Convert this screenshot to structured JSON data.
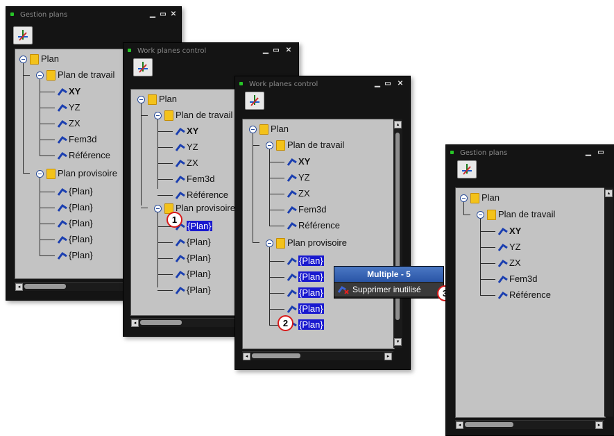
{
  "windows": [
    {
      "title": "Gestion plans",
      "tree": {
        "root": "Plan",
        "workplanes_folder": "Plan de travail",
        "workplanes": [
          "XY",
          "YZ",
          "ZX",
          "Fem3d",
          "Référence"
        ],
        "temp_folder": "Plan provisoire",
        "temp_planes": [
          "{Plan}",
          "{Plan}",
          "{Plan}",
          "{Plan}",
          "{Plan}"
        ]
      }
    },
    {
      "title": "Work planes control",
      "tree": {
        "root": "Plan",
        "workplanes_folder": "Plan de travail",
        "workplanes": [
          "XY",
          "YZ",
          "ZX",
          "Fem3d",
          "Référence"
        ],
        "temp_folder": "Plan provisoire",
        "temp_planes": [
          "{Plan}",
          "{Plan}",
          "{Plan}",
          "{Plan}",
          "{Plan}"
        ]
      },
      "callout": "1"
    },
    {
      "title": "Work planes control",
      "tree": {
        "root": "Plan",
        "workplanes_folder": "Plan de travail",
        "workplanes": [
          "XY",
          "YZ",
          "ZX",
          "Fem3d",
          "Référence"
        ],
        "temp_folder": "Plan provisoire",
        "temp_planes": [
          "{Plan}",
          "{Plan}",
          "{Plan}",
          "{Plan}",
          "{Plan}"
        ]
      },
      "callout": "2",
      "context_menu": {
        "header": "Multiple - 5",
        "item": "Supprimer inutilisé",
        "callout": "3"
      }
    },
    {
      "title": "Gestion plans",
      "tree": {
        "root": "Plan",
        "workplanes_folder": "Plan de travail",
        "workplanes": [
          "XY",
          "YZ",
          "ZX",
          "Fem3d",
          "Référence"
        ]
      }
    }
  ],
  "colors": {
    "selection": "#1919cf",
    "callout_ring": "#d81a1a",
    "menu_header": "#2a55a6",
    "panel_bg": "#c3c3c3"
  },
  "icons": [
    "window-control-minimize-icon",
    "window-control-maximize-icon",
    "close-icon",
    "axes-tool-icon",
    "folder-icon",
    "plane-icon",
    "collapse-icon"
  ]
}
